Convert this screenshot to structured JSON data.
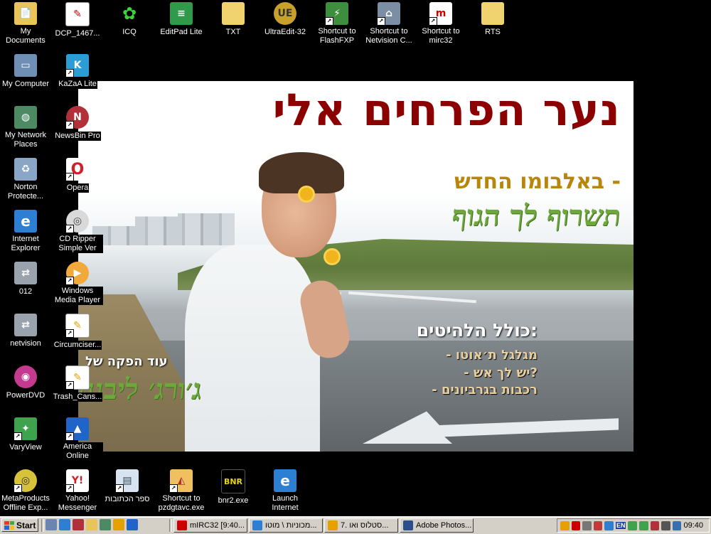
{
  "desktop_icons": [
    {
      "label": "My Documents",
      "icon": "folder-documents-icon"
    },
    {
      "label": "DCP_1467...",
      "icon": "image-file-icon"
    },
    {
      "label": "ICQ",
      "icon": "icq-flower-icon"
    },
    {
      "label": "EditPad Lite",
      "icon": "editpad-icon"
    },
    {
      "label": "TXT",
      "icon": "folder-icon"
    },
    {
      "label": "UltraEdit-32",
      "icon": "ultraedit-icon"
    },
    {
      "label": "Shortcut to FlashFXP",
      "icon": "flashfxp-icon"
    },
    {
      "label": "Shortcut to Netvision C...",
      "icon": "network-icon"
    },
    {
      "label": "Shortcut to mirc32",
      "icon": "mirc-icon"
    },
    {
      "label": "RTS",
      "icon": "folder-icon"
    },
    {
      "label": "My Computer",
      "icon": "computer-icon"
    },
    {
      "label": "KaZaA Lite",
      "icon": "kazaa-icon"
    },
    {
      "label": "My Network Places",
      "icon": "network-places-icon"
    },
    {
      "label": "NewsBin Pro",
      "icon": "newsbin-icon"
    },
    {
      "label": "Norton Protecte...",
      "icon": "recycle-bin-icon"
    },
    {
      "label": "Opera",
      "icon": "opera-icon"
    },
    {
      "label": "Internet Explorer",
      "icon": "internet-explorer-icon"
    },
    {
      "label": "CD Ripper Simple Ver",
      "icon": "cd-icon"
    },
    {
      "label": "012",
      "icon": "network-connection-icon"
    },
    {
      "label": "Windows Media Player",
      "icon": "media-player-icon"
    },
    {
      "label": "netvision",
      "icon": "network-connection-icon"
    },
    {
      "label": "Circumciser...",
      "icon": "document-icon"
    },
    {
      "label": "PowerDVD",
      "icon": "powerdvd-icon"
    },
    {
      "label": "Trash_Cans...",
      "icon": "document-icon"
    },
    {
      "label": "VaryView",
      "icon": "varyview-icon"
    },
    {
      "label": "America Online",
      "icon": "aol-icon"
    },
    {
      "label": "MetaProducts Offline Exp...",
      "icon": "metaproducts-icon"
    },
    {
      "label": "Yahoo! Messenger",
      "icon": "yahoo-messenger-icon"
    },
    {
      "label": "ספר הכתובות",
      "icon": "address-book-icon"
    },
    {
      "label": "Shortcut to pzdgtavc.exe",
      "icon": "pizza-icon"
    },
    {
      "label": "bnr2.exe",
      "icon": "bnr2-icon"
    },
    {
      "label": "Launch Internet",
      "icon": "internet-explorer-icon"
    }
  ],
  "wallpaper": {
    "title": "נער הפרחים אלי",
    "subtitle": "באלבומו החדש -",
    "album": "תשרוף לך הגוף",
    "includes": "כולל הלהיטים:",
    "tracks": [
      "- מגלגל ת׳אוטו",
      "- יש לך אש?",
      "- רכבות בגרביונים"
    ],
    "production": "עוד הפקה של",
    "producer": "ג׳ורג׳ ליבנה"
  },
  "taskbar": {
    "start_label": "Start",
    "quick_launch": [
      "desktop-icon",
      "internet-explorer-icon",
      "media-icon",
      "folder-icon",
      "network-icon",
      "winamp-icon",
      "outlook-icon"
    ],
    "tasks": [
      {
        "label": "mIRC32 [9:40...",
        "icon": "mirc-icon"
      },
      {
        "label": "מכוניות \\ מוטו...",
        "icon": "internet-explorer-icon"
      },
      {
        "label": "7. סטלוס ואו...",
        "icon": "winamp-icon"
      },
      {
        "label": "Adobe Photos...",
        "icon": "photoshop-icon"
      }
    ],
    "tray": {
      "language": "EN",
      "clock": "09:40"
    }
  },
  "colors": {
    "desktop_bg": "#000000",
    "taskbar_bg": "#d4d0c8",
    "title_red": "#8b0000",
    "album_green": "#6fa83a"
  }
}
